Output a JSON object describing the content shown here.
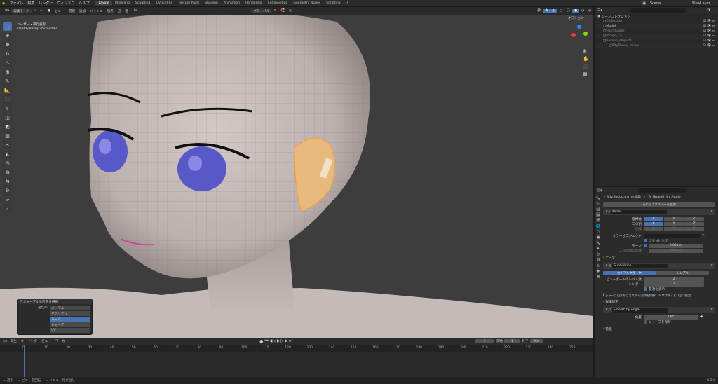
{
  "topbar": {
    "menus": [
      "ファイル",
      "編集",
      "レンダー",
      "ウィンドウ",
      "ヘルプ"
    ],
    "workspaces": [
      "Layout",
      "Modeling",
      "Sculpting",
      "UV Editing",
      "Texture Paint",
      "Shading",
      "Animation",
      "Rendering",
      "Compositing",
      "Geometry Nodes",
      "Scripting"
    ],
    "active_workspace": "Layout",
    "scene_label": "Scene",
    "viewlayer_label": "ViewLayer"
  },
  "viewport": {
    "mode": "編集モード",
    "menus": [
      "ビュー",
      "選択",
      "追加",
      "メッシュ",
      "頂点",
      "辺",
      "面",
      "UV"
    ],
    "transform": "グローバル",
    "overlay_label": "オプション",
    "info_line1": "ユーザー・平行投影",
    "info_line2": "(1) Bdy.Bakup.mirror.002"
  },
  "operator_panel": {
    "title": "シャープする辺を並選択",
    "field_label": "区切り",
    "options": [
      "ノーマル",
      "マテリアル",
      "シーム",
      "シャープ",
      "UV"
    ],
    "selected_index": 2
  },
  "timeline": {
    "menus": [
      "再生",
      "キーイング",
      "ビュー",
      "マーカー"
    ],
    "current_frame": "1",
    "start_label": "開始",
    "start": "1",
    "end_label": "終了",
    "end": "250",
    "ticks": [
      "0",
      "10",
      "20",
      "30",
      "40",
      "50",
      "60",
      "70",
      "80",
      "90",
      "100",
      "110",
      "120",
      "130",
      "140",
      "150",
      "160",
      "170",
      "180",
      "190",
      "200",
      "210",
      "220",
      "230",
      "240",
      "250"
    ]
  },
  "status": {
    "items": [
      "選択",
      "ビューを回転",
      "メニュー呼び出し"
    ],
    "version": "4.3.0"
  },
  "outliner": {
    "header": "シーンコレクション",
    "items": [
      {
        "label": "Collection",
        "dim": true,
        "indent": 1
      },
      {
        "label": "Model",
        "dim": false,
        "indent": 1
      },
      {
        "label": "HairShapes",
        "dim": true,
        "indent": 1
      },
      {
        "label": "Image_CF",
        "dim": true,
        "indent": 1
      },
      {
        "label": "Backup_Objects",
        "dim": true,
        "indent": 1
      },
      {
        "label": "Bdy.Bakup.mirror",
        "dim": true,
        "indent": 2
      }
    ]
  },
  "properties": {
    "object_name": "Bdy.Bakup.mirror.002",
    "modifier_name": "Smooth by Angle",
    "add_modifier": "モディファイアーを追加",
    "mirror": {
      "name": "Mirror",
      "axis_label": "座標軸",
      "bisect_label": "二分割",
      "flip_label": "反転",
      "axes": [
        "X",
        "Y",
        "Z"
      ],
      "mirror_object_label": "ミラーオブジェクト",
      "clipping_label": "クリッピング",
      "merge_label": "マージ",
      "merge_value": "0.001 m",
      "bisect_distance_label": "二分割時の距離",
      "bisect_distance_value": "0.001 m",
      "data_label": "データ"
    },
    "subdivision": {
      "name": "Subdivision",
      "tabs": [
        "カトマルクラーク",
        "シンプル"
      ],
      "viewport_label": "ビューポートのレベル数",
      "viewport_value": "2",
      "render_label": "レンダー",
      "render_value": "2",
      "optimal_label": "最適化表示",
      "info": "シャープ辺またはカスタム法線を保持: 3/4サブディビジョン推奨",
      "advanced_label": "詳細設定"
    },
    "smooth": {
      "name": "Smooth by Angle",
      "angle_label": "角度",
      "angle_value": "180°",
      "keep_sharp_label": "シャープを保持",
      "manage_label": "管理"
    }
  }
}
